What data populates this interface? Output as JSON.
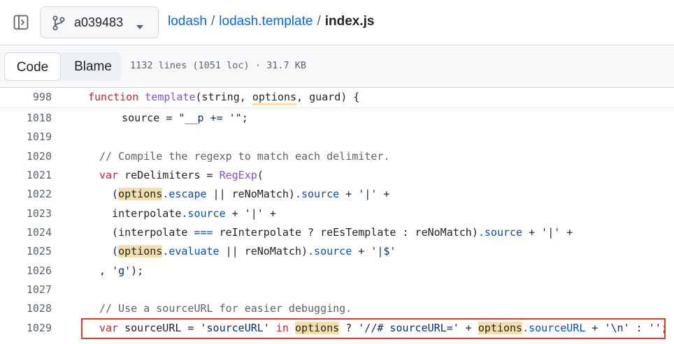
{
  "header": {
    "branch": "a039483",
    "breadcrumb": {
      "repo": "lodash",
      "folder": "lodash.template",
      "separator": "/",
      "file": "index.js"
    }
  },
  "file_bar": {
    "tab_code": "Code",
    "tab_blame": "Blame",
    "meta": "1132 lines (1051 loc) · 31.7 KB"
  },
  "code": {
    "lines": [
      {
        "n": "998"
      },
      {
        "n": "1018"
      },
      {
        "n": "1019"
      },
      {
        "n": "1020"
      },
      {
        "n": "1021"
      },
      {
        "n": "1022"
      },
      {
        "n": "1023"
      },
      {
        "n": "1024"
      },
      {
        "n": "1025"
      },
      {
        "n": "1026"
      },
      {
        "n": "1027"
      },
      {
        "n": "1028"
      },
      {
        "n": "1029"
      }
    ],
    "tokens": {
      "l998_kw": "function",
      "l998_fn": "template",
      "l998_open": "(string, ",
      "l998_opt": "options",
      "l998_rest": ", guard) {",
      "l1018_pre": "    source = ",
      "l1018_str": "\"__p += '\"",
      "l1018_end": ";",
      "l1020_com": "// Compile the regexp to match each delimiter.",
      "l1021_kw": "var",
      "l1021_mid": " reDelimiters = ",
      "l1021_fn": "RegExp",
      "l1021_end": "(",
      "l1022_a": "  (",
      "l1022_opt": "options",
      "l1022_prop": ".escape",
      "l1022_b": " || reNoMatch)",
      "l1022_src": ".source",
      "l1022_c": " + ",
      "l1022_str": "'|'",
      "l1022_d": " +",
      "l1023_a": "  interpolate",
      "l1023_src": ".source",
      "l1023_b": " + ",
      "l1023_str": "'|'",
      "l1023_c": " +",
      "l1024_a": "  (interpolate ",
      "l1024_op": "===",
      "l1024_b": " reInterpolate ? reEsTemplate : reNoMatch)",
      "l1024_src": ".source",
      "l1024_c": " + ",
      "l1024_str": "'|'",
      "l1024_d": " +",
      "l1025_a": "  (",
      "l1025_opt": "options",
      "l1025_prop": ".evaluate",
      "l1025_b": " || reNoMatch)",
      "l1025_src": ".source",
      "l1025_c": " + ",
      "l1025_str": "'|$'",
      "l1026_a": ", ",
      "l1026_str": "'g'",
      "l1026_b": ");",
      "l1028_com": "// Use a sourceURL for easier debugging.",
      "l1029_kw": "var",
      "l1029_a": " sourceURL = ",
      "l1029_str1": "'sourceURL'",
      "l1029_in": " in ",
      "l1029_opt1": "options",
      "l1029_b": " ? ",
      "l1029_str2": "'//# sourceURL='",
      "l1029_c": " + ",
      "l1029_opt2": "options",
      "l1029_prop": ".sourceURL",
      "l1029_d": " + ",
      "l1029_str3": "'\\n'",
      "l1029_e": " : ",
      "l1029_str4": "''",
      "l1029_f": ";"
    }
  },
  "colors": {
    "keyword": "#cf222e",
    "function": "#8250df",
    "string": "#0a3069",
    "comment": "#59636e",
    "property": "#0550ae",
    "match_highlight": "#f5dfa8",
    "focus_box": "#e53a1f"
  },
  "icons": {
    "sidebar_toggle": "sidebar-expand-icon",
    "branch": "git-branch-icon",
    "caret": "triangle-down-icon"
  }
}
